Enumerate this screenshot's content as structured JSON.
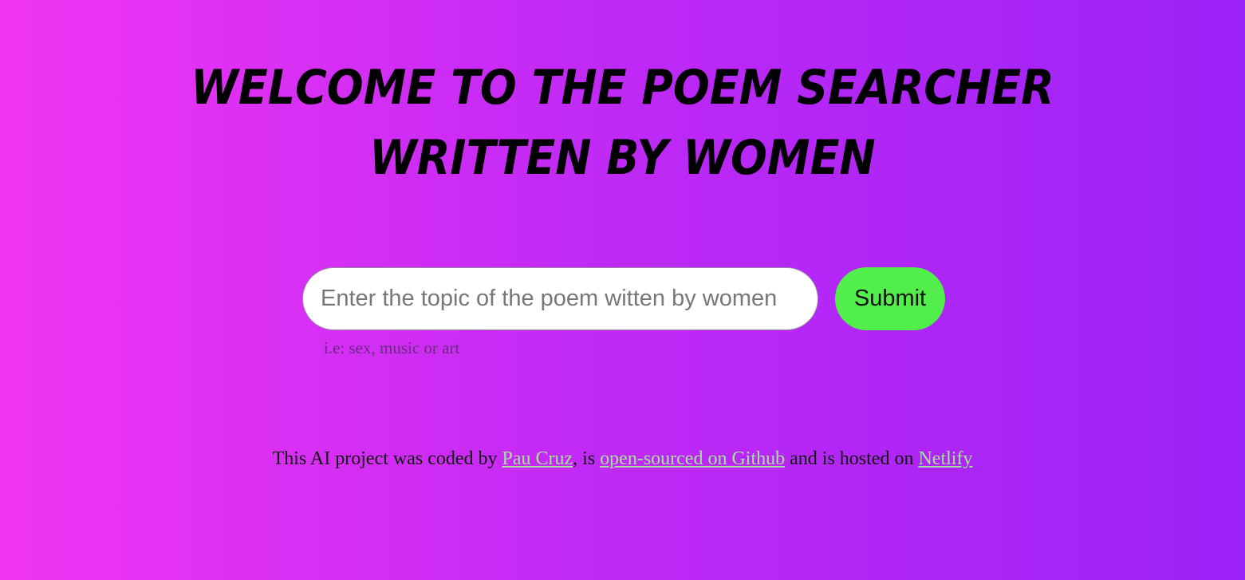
{
  "header": {
    "title_line1": "WELCOME TO THE POEM SEARCHER",
    "title_line2": "WRITTEN BY WOMEN"
  },
  "search": {
    "placeholder": "Enter the topic of the poem witten by women",
    "value": "",
    "submit_label": "Submit",
    "hint": "i.e: sex, music or art"
  },
  "footer": {
    "text_before": "This AI project was coded by ",
    "author_link": "Pau Cruz",
    "text_middle": ", is ",
    "github_link": "open-sourced on Github",
    "text_after": " and is hosted on ",
    "host_link": "Netlify"
  },
  "colors": {
    "background_start": "#f135f3",
    "background_end": "#9b22f7",
    "submit_button": "#51ee4c",
    "link": "#a7e29a"
  }
}
